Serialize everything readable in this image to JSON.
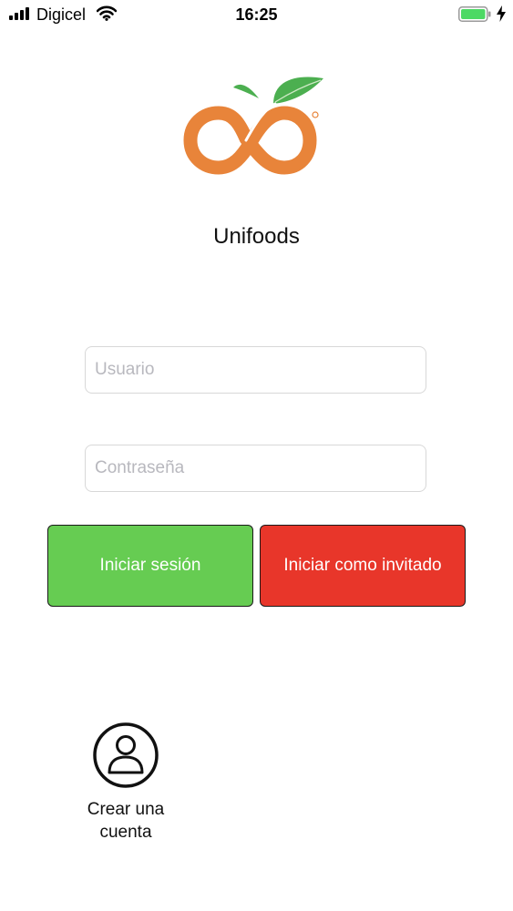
{
  "status_bar": {
    "carrier": "Digicel",
    "time": "16:25",
    "signal_icon": "signal-bars-icon",
    "wifi_icon": "wifi-icon",
    "battery_icon": "battery-icon",
    "charging_icon": "charging-bolt-icon"
  },
  "brand": {
    "logo_icon": "unifoods-logo",
    "title": "Unifoods",
    "colors": {
      "orange": "#e8843a",
      "leaf_green": "#4caf50"
    }
  },
  "login_form": {
    "username": {
      "value": "",
      "placeholder": "Usuario"
    },
    "password": {
      "value": "",
      "placeholder": "Contraseña"
    },
    "login_button": {
      "label": "Iniciar sesión",
      "color": "#66cc52"
    },
    "guest_button": {
      "label": "Iniciar como invitado",
      "color": "#e8362a"
    }
  },
  "create_account": {
    "icon": "user-circle-icon",
    "label": "Crear una cuenta"
  }
}
